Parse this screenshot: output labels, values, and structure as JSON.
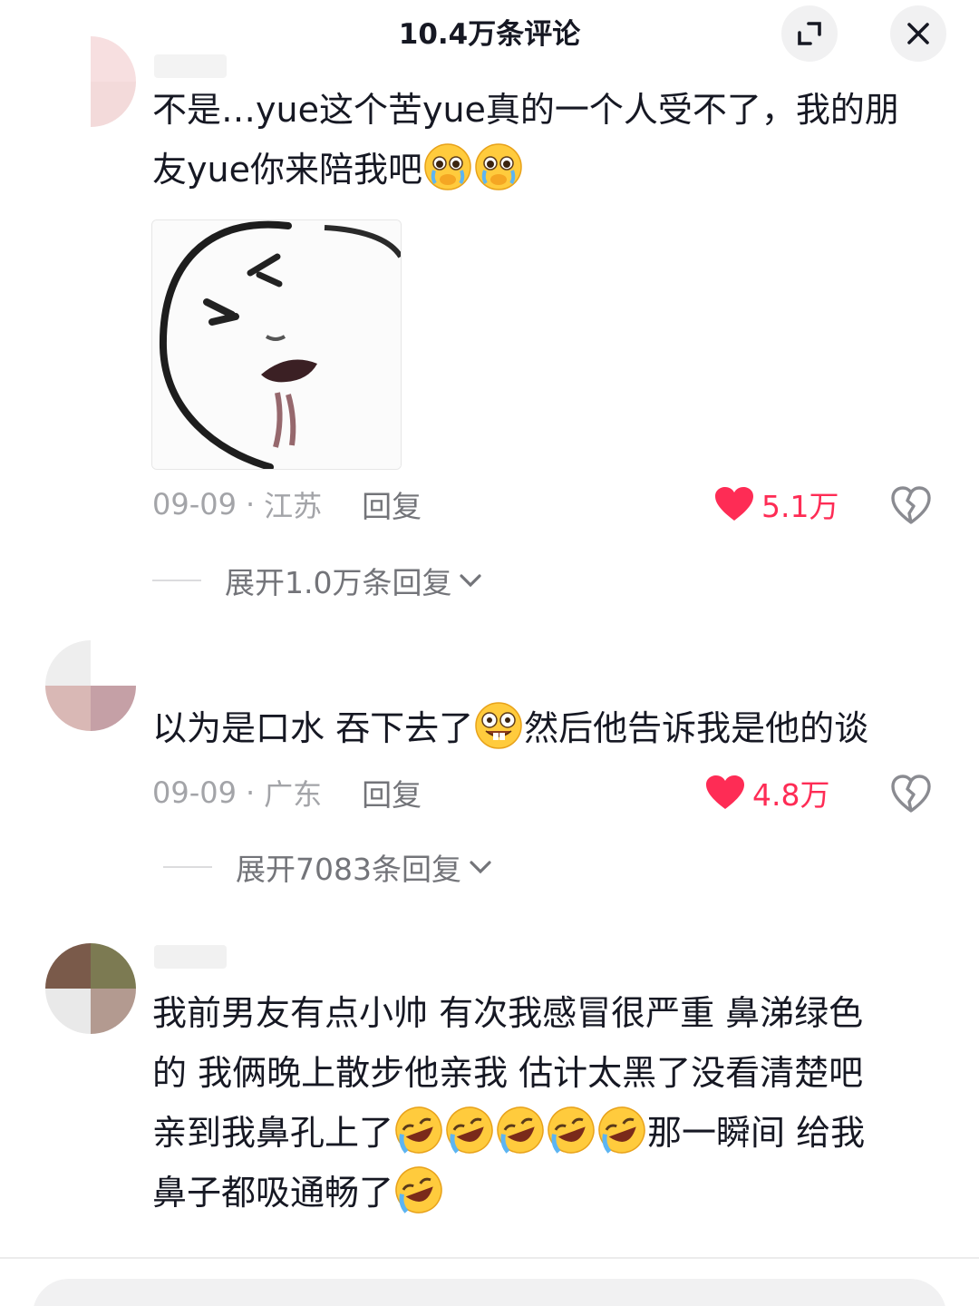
{
  "header": {
    "title": "10.4万条评论",
    "expand_icon": "expand-icon",
    "close_icon": "close-icon"
  },
  "comments": [
    {
      "text": "不是…yue这个苦yue真的一个人受不了，我的朋友yue你来陪我吧",
      "emojis_after": [
        "pleading-cry-emoji",
        "pleading-cry-emoji"
      ],
      "has_image": true,
      "date": "09-09",
      "location": "江苏",
      "reply_label": "回复",
      "likes": "5.1万",
      "expand_label": "展开1.0万条回复"
    },
    {
      "text_before": "以为是口水 吞下去了",
      "text_after": "然后他告诉我是他的谈",
      "emoji_inline": "buck-tooth-grin-emoji",
      "date": "09-09",
      "location": "广东",
      "reply_label": "回复",
      "likes": "4.8万",
      "expand_label": "展开7083条回复"
    },
    {
      "text_lines": [
        "我前男友有点小帅 有次我感冒很严重 鼻涕绿色",
        "的 我俩晚上散步他亲我 估计太黑了没看清楚吧",
        "亲到我鼻孔上了",
        "那一瞬间 给我",
        "鼻子都吸通畅了"
      ],
      "emojis_line3": [
        "rofl-emoji",
        "rofl-emoji",
        "rofl-emoji",
        "rofl-emoji",
        "rofl-emoji"
      ],
      "emojis_line4_end": [
        "rofl-emoji"
      ]
    }
  ],
  "colors": {
    "like_red": "#fe2c55",
    "meta_gray": "#a3a4a8",
    "text": "#161823"
  }
}
